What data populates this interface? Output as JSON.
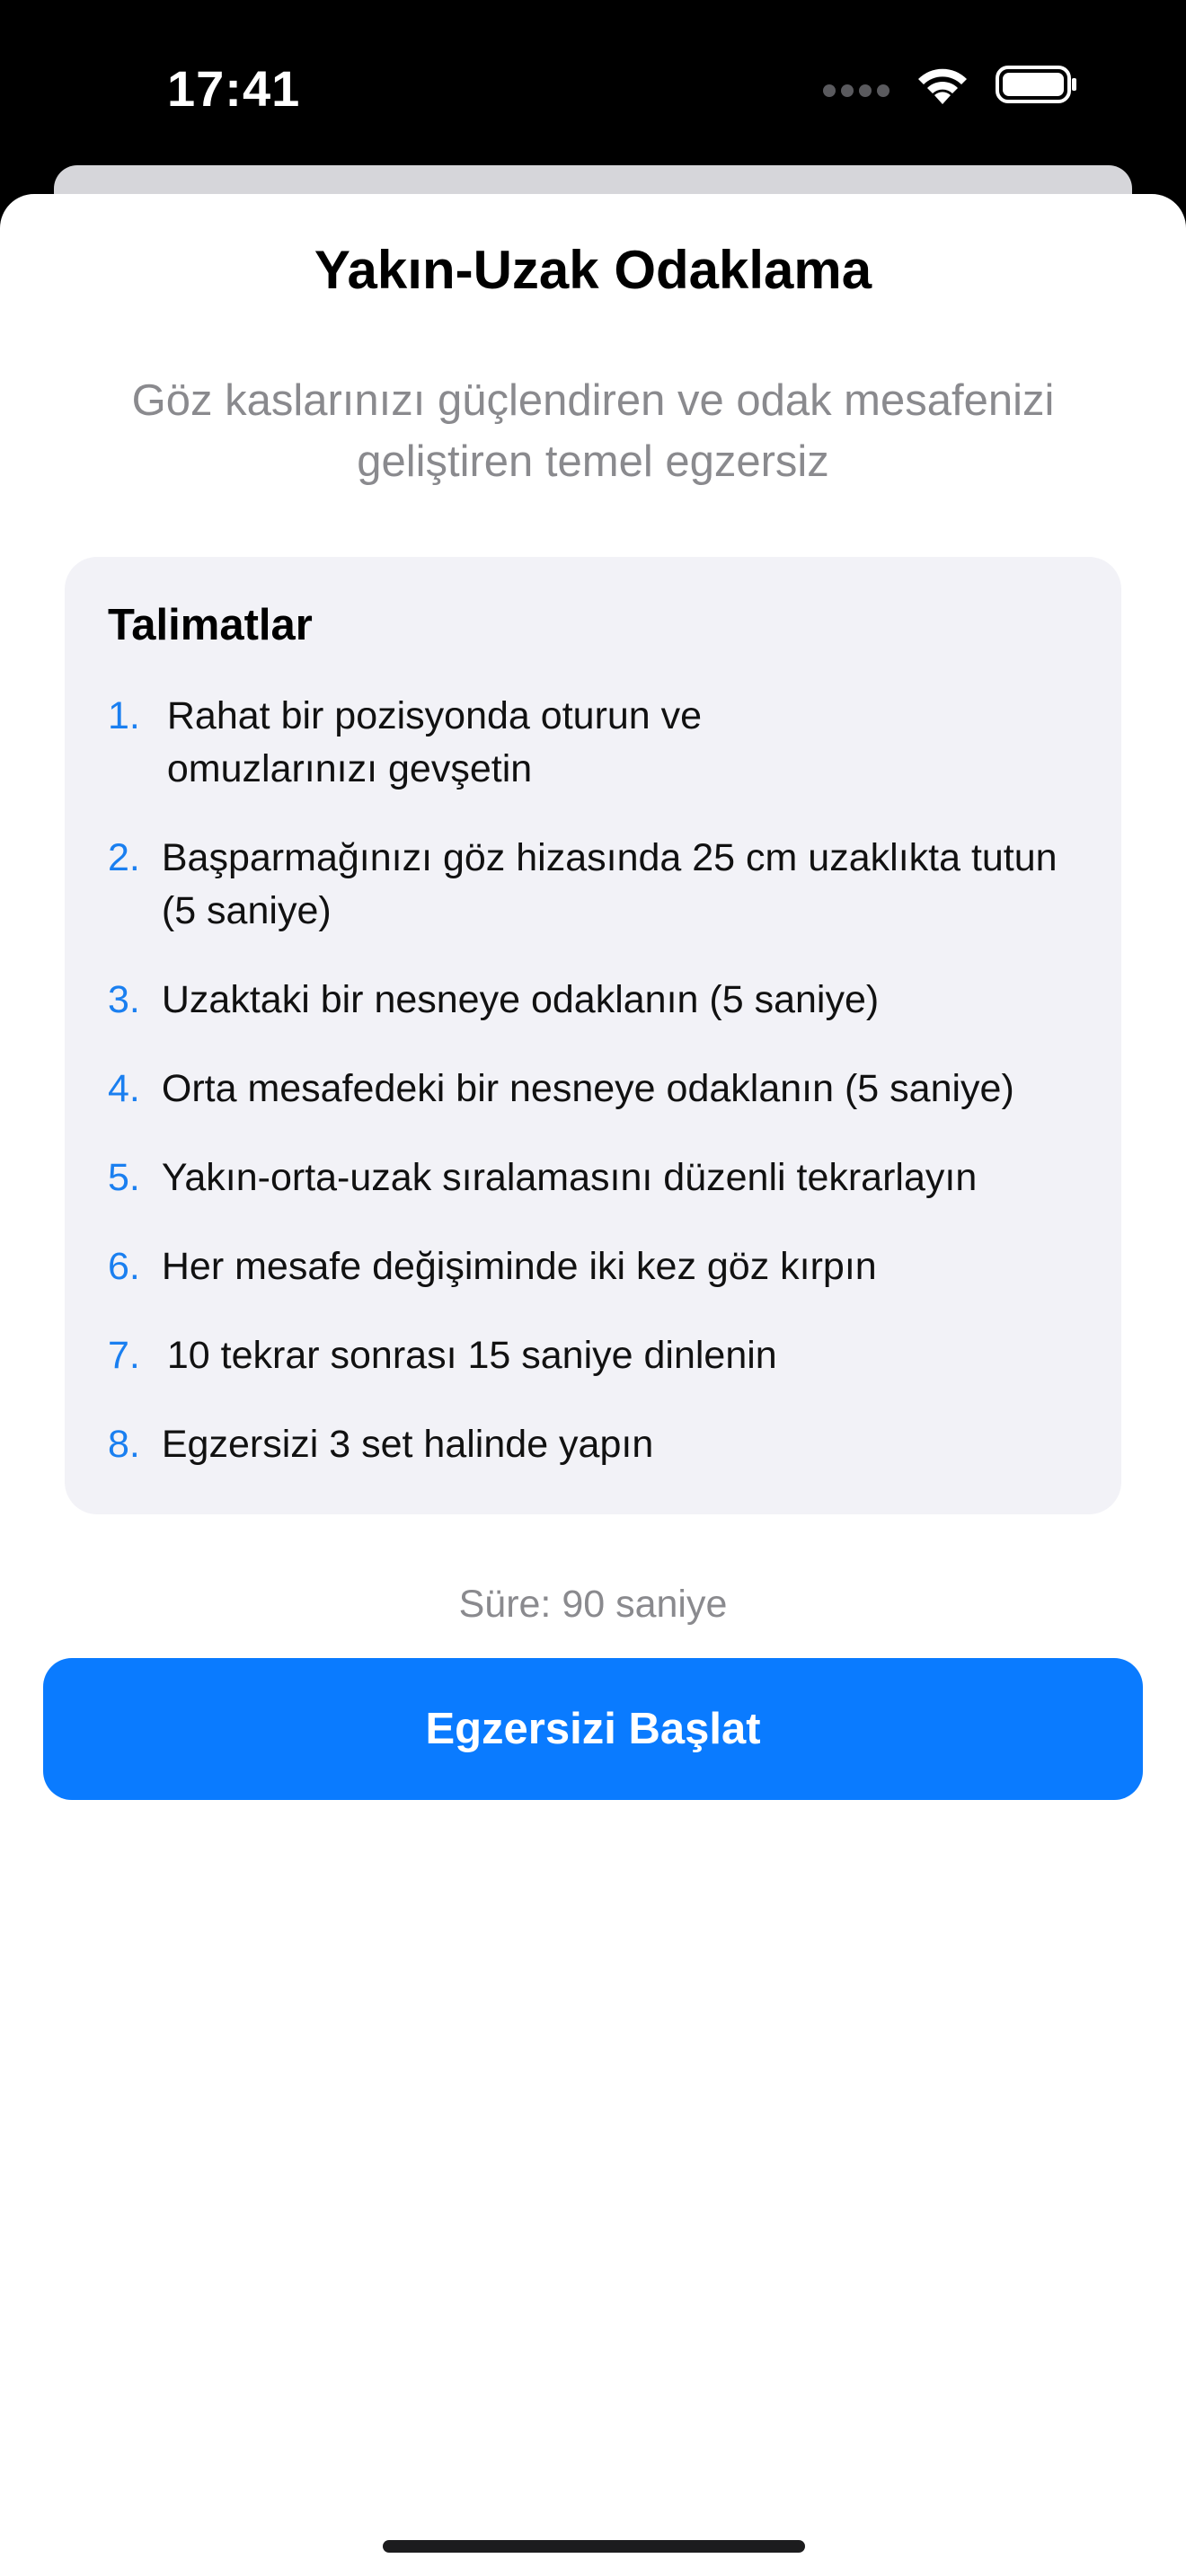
{
  "status_bar": {
    "time": "17:41",
    "icons": [
      "cellular-signal-icon",
      "wifi-icon",
      "battery-icon"
    ]
  },
  "sheet": {
    "title": "Yakın-Uzak Odaklama",
    "subtitle": "Göz kaslarınızı güçlendiren ve odak mesafenizi geliştiren temel egzersiz",
    "instructions": {
      "heading": "Talimatlar",
      "steps": [
        {
          "number": "1.",
          "text": "Rahat bir pozisyonda oturun ve omuzlarınızı gevşetin"
        },
        {
          "number": "2.",
          "text": "Başparmağınızı göz hizasında 25 cm uzaklıkta tutun (5 saniye)"
        },
        {
          "number": "3.",
          "text": "Uzaktaki bir nesneye odaklanın (5 saniye)"
        },
        {
          "number": "4.",
          "text": "Orta mesafedeki bir nesneye odaklanın (5 saniye)"
        },
        {
          "number": "5.",
          "text": "Yakın-orta-uzak sıralamasını düzenli tekrarlayın"
        },
        {
          "number": "6.",
          "text": "Her mesafe değişiminde iki kez göz kırpın"
        },
        {
          "number": "7.",
          "text": "10 tekrar sonrası 15 saniye dinlenin"
        },
        {
          "number": "8.",
          "text": "Egzersizi 3 set halinde yapın"
        }
      ]
    },
    "duration": "Süre: 90 saniye",
    "start_button_label": "Egzersizi Başlat"
  },
  "colors": {
    "accent": "#0a7bff",
    "step_number": "#1a7ff0",
    "secondary_text": "#8a8a8e",
    "card_background": "#f2f2f7"
  }
}
